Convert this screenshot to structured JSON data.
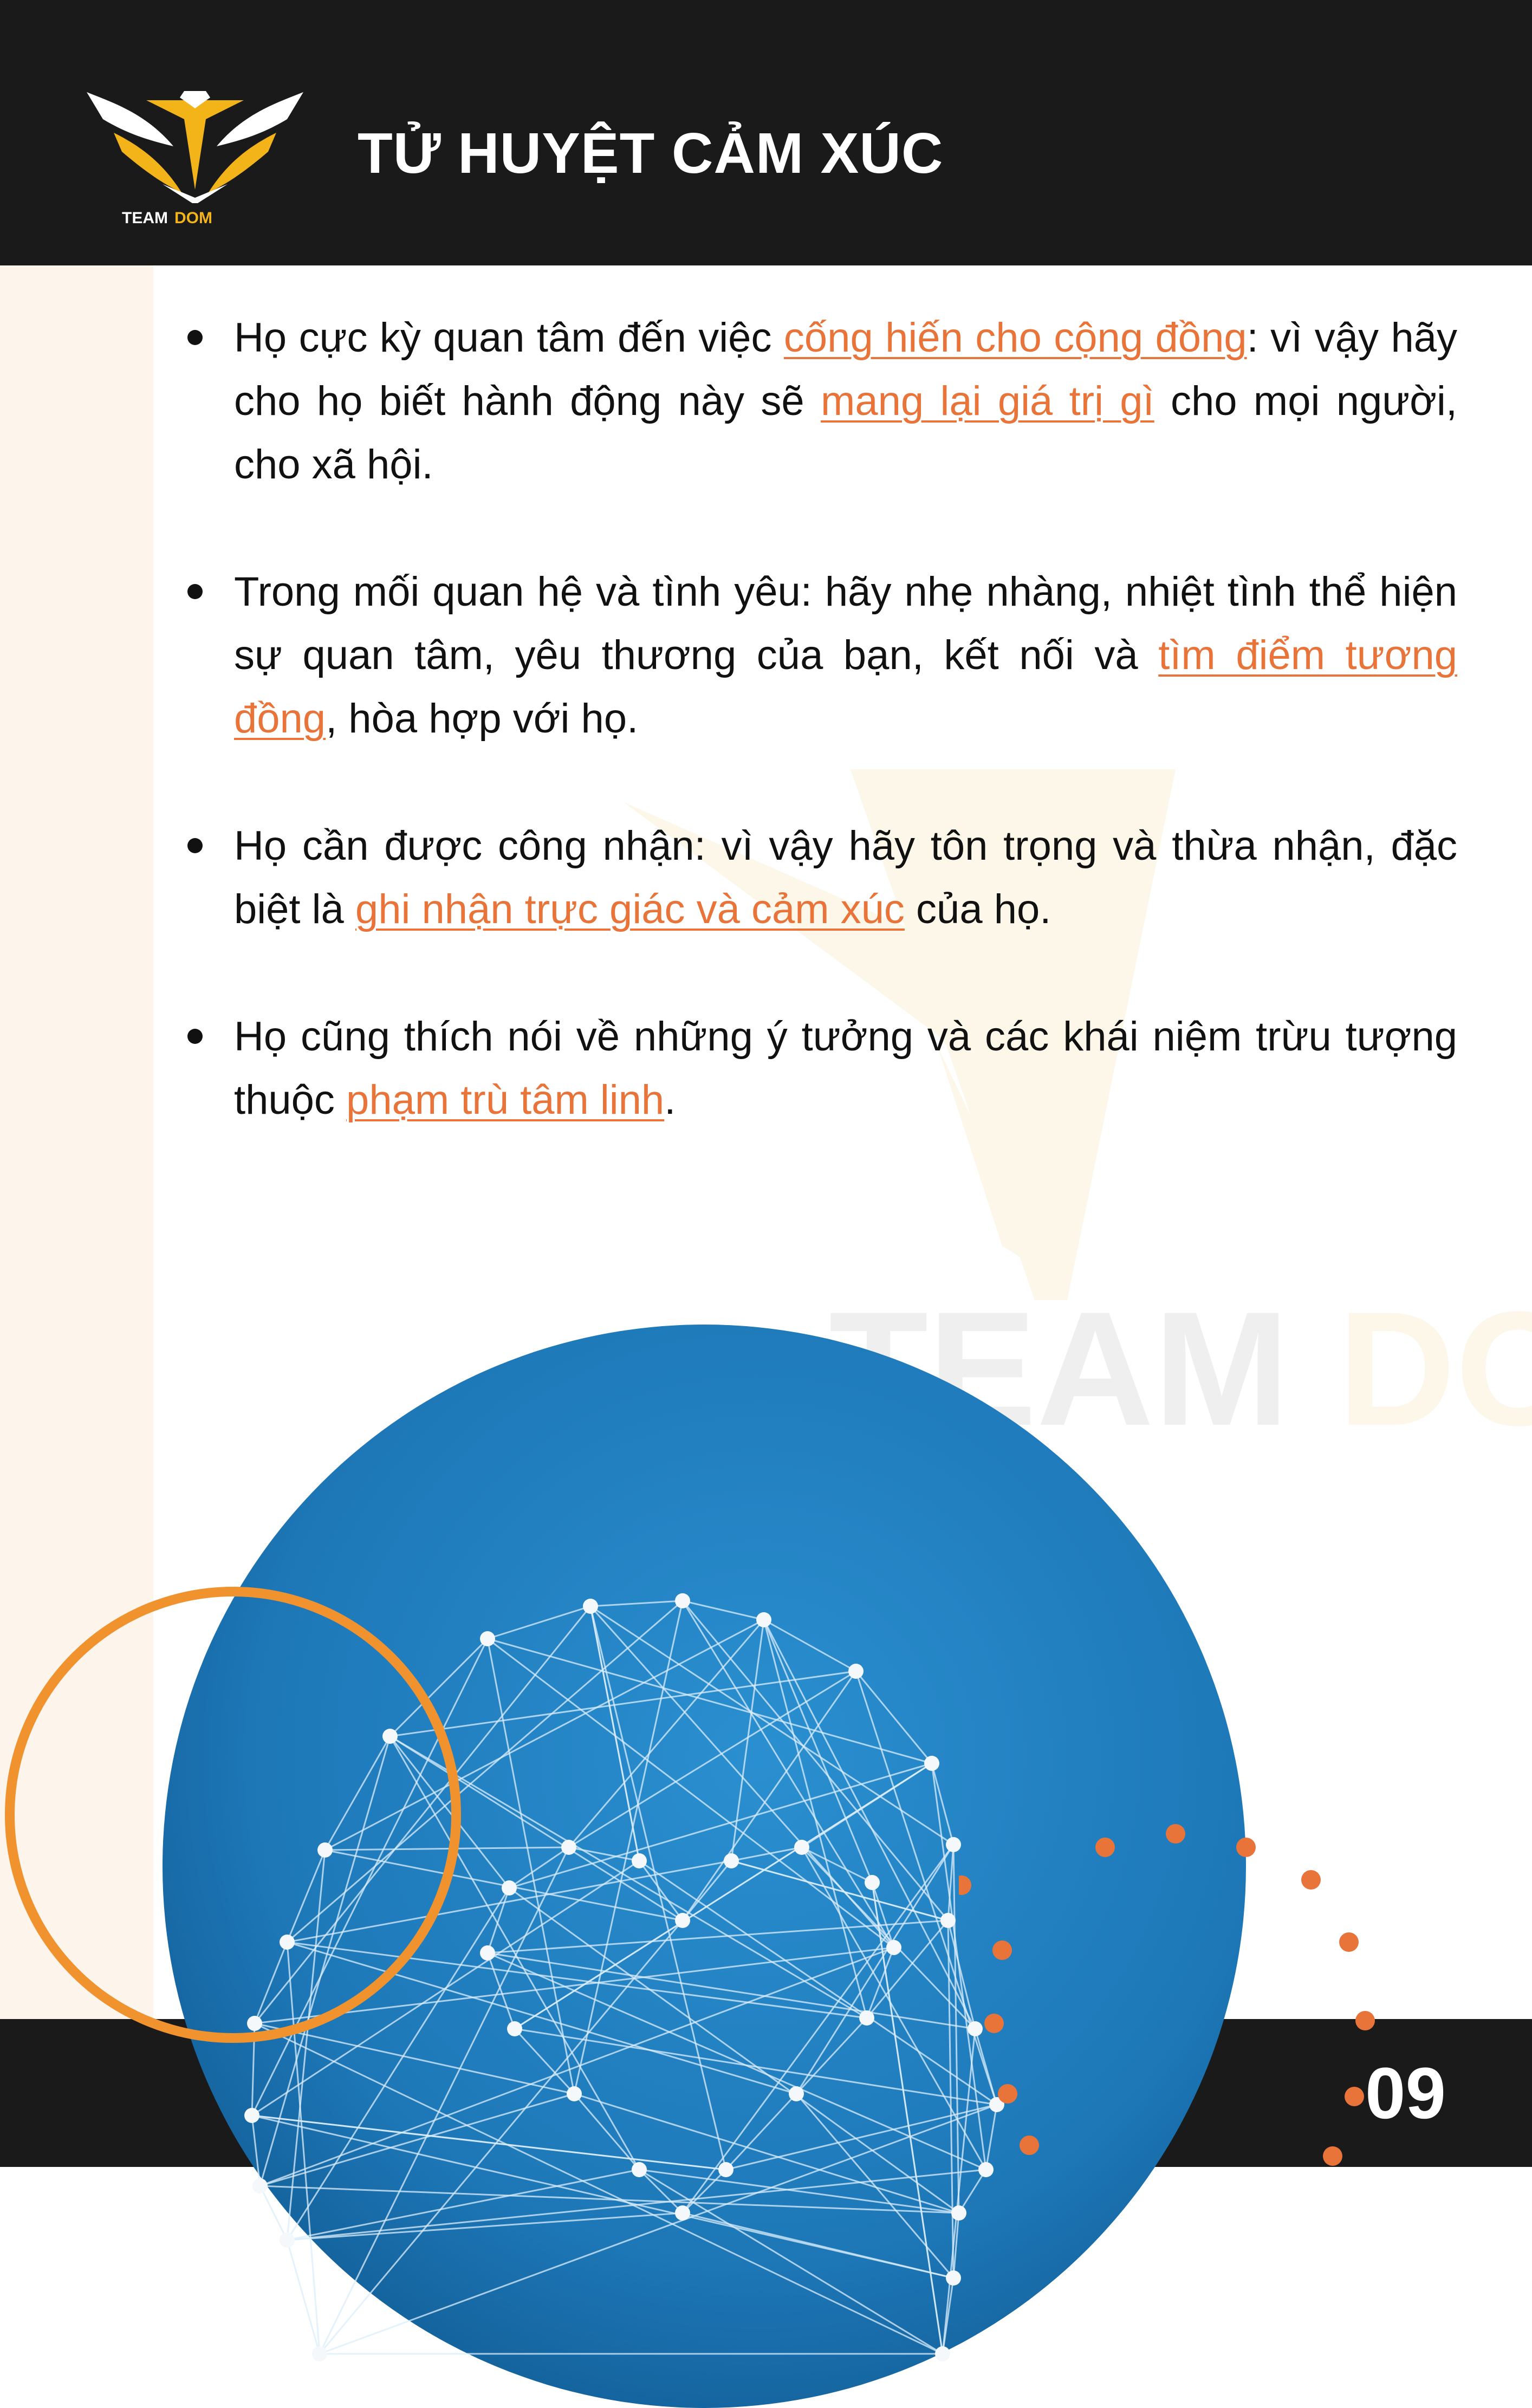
{
  "header": {
    "title": "TỬ HUYỆT CẢM XÚC",
    "logo_text_1": "TEAM",
    "logo_text_2": "DOM"
  },
  "watermark": {
    "text_1": "TEAM",
    "text_2": "DOM"
  },
  "bullets": [
    {
      "parts": [
        {
          "text": "Họ cực kỳ quan tâm đến việc ",
          "hl": false
        },
        {
          "text": "cống hiến cho cộng đồng",
          "hl": true
        },
        {
          "text": ": vì vậy hãy cho họ biết hành động này sẽ ",
          "hl": false
        },
        {
          "text": "mang lại giá trị gì",
          "hl": true
        },
        {
          "text": " cho mọi người, cho xã hội.",
          "hl": false
        }
      ]
    },
    {
      "parts": [
        {
          "text": "Trong mối quan hệ và tình yêu: hãy nhẹ nhàng, nhiệt tình thể hiện sự quan tâm, yêu thương của bạn, kết nối và ",
          "hl": false
        },
        {
          "text": "tìm điểm tương đồng",
          "hl": true
        },
        {
          "text": ", hòa hợp với họ.",
          "hl": false
        }
      ]
    },
    {
      "parts": [
        {
          "text": "Họ cần được công nhận: vì vậy hãy tôn trọng và thừa nhận, đặc biệt là ",
          "hl": false
        },
        {
          "text": "ghi nhận trực giác và cảm xúc",
          "hl": true
        },
        {
          "text": " của họ.",
          "hl": false
        }
      ]
    },
    {
      "parts": [
        {
          "text": "Họ cũng thích nói về những ý tưởng và các khái niệm trừu tượng thuộc ",
          "hl": false
        },
        {
          "text": "phạm trù tâm linh",
          "hl": true
        },
        {
          "text": ".",
          "hl": false
        }
      ]
    }
  ],
  "page_number": "09",
  "colors": {
    "dark": "#1a1a1a",
    "accent_orange": "#e8743a",
    "ring_orange": "#f0922e",
    "gold": "#f2b418",
    "blue": "#1f7fc0",
    "cream": "#fdf4ec"
  }
}
